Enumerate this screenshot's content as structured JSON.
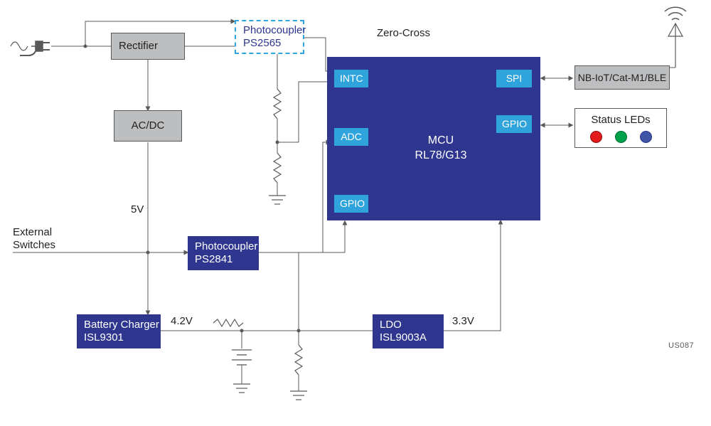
{
  "blocks": {
    "rectifier": "Rectifier",
    "photocoupler1": {
      "l1": "Photocoupler",
      "l2": "PS2565"
    },
    "acdc": "AC/DC",
    "photocoupler2": {
      "l1": "Photocoupler",
      "l2": "PS2841"
    },
    "battery_charger": {
      "l1": "Battery Charger",
      "l2": "ISL9301"
    },
    "ldo": {
      "l1": "LDO",
      "l2": "ISL9003A"
    },
    "nbiot": "NB-IoT/Cat-M1/BLE",
    "status_leds": "Status LEDs"
  },
  "mcu": {
    "name": "MCU",
    "part": "RL78/G13",
    "chips": {
      "intc": "INTC",
      "adc": "ADC",
      "gpio1": "GPIO",
      "spi": "SPI",
      "gpio2": "GPIO"
    }
  },
  "labels": {
    "zero_cross": "Zero-Cross",
    "external_switches": {
      "l1": "External",
      "l2": "Switches"
    },
    "v5": "5V",
    "v4_2": "4.2V",
    "v3_3": "3.3V"
  },
  "stub": "US087"
}
